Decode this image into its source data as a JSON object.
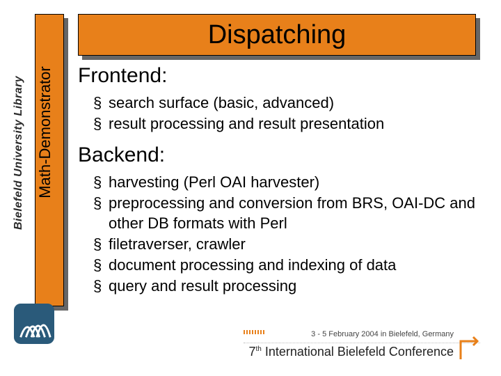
{
  "title": "Dispatching",
  "side_label": "Math-Demonstrator",
  "library_logo_text": "Bielefeld University Library",
  "sections": {
    "frontend": {
      "heading": "Frontend:",
      "items": [
        "search surface (basic, advanced)",
        "result processing and result presentation"
      ]
    },
    "backend": {
      "heading": "Backend:",
      "items": [
        "harvesting (Perl OAI harvester)",
        "preprocessing and conversion from BRS, OAI-DC and other DB formats with Perl",
        "filetraverser, crawler",
        "document processing and indexing of data",
        "query and result processing"
      ]
    }
  },
  "footer": {
    "date_location": "3 - 5 February 2004 in Bielefeld, Germany",
    "ordinal": "7",
    "ordinal_suffix": "th",
    "conference": " International Bielefeld Conference"
  },
  "colors": {
    "accent": "#e8801a",
    "shadow": "#666666"
  }
}
